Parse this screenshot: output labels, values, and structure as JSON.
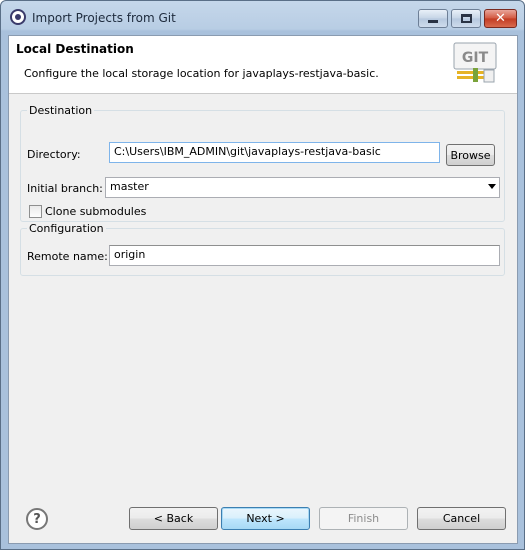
{
  "window": {
    "title": "Import Projects from Git",
    "minimize_icon": "minimize-icon",
    "maximize_icon": "maximize-icon",
    "close_icon": "close-icon"
  },
  "header": {
    "title": "Local Destination",
    "description": "Configure the local storage location for javaplays-restjava-basic.",
    "logo_text": "GIT"
  },
  "destination": {
    "group_label": "Destination",
    "directory_label": "Directory:",
    "directory_value": "C:\\Users\\IBM_ADMIN\\git\\javaplays-restjava-basic",
    "browse_label": "Browse",
    "initial_branch_label": "Initial branch:",
    "initial_branch_value": "master",
    "clone_submodules_label": "Clone submodules",
    "clone_submodules_checked": false
  },
  "configuration": {
    "group_label": "Configuration",
    "remote_name_label": "Remote name:",
    "remote_name_value": "origin"
  },
  "footer": {
    "help_icon": "help-icon",
    "back_label": "< Back",
    "next_label": "Next >",
    "finish_label": "Finish",
    "cancel_label": "Cancel"
  },
  "colors": {
    "titlebar": "#b8cde4",
    "dialog_bg": "#f0f0f0",
    "close_button": "#c23b23",
    "focus_border": "#7eb4ea"
  }
}
